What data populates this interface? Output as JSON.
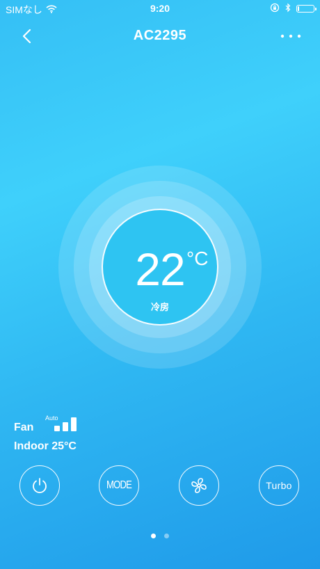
{
  "status_bar": {
    "carrier": "SIMなし",
    "time": "9:20",
    "icons": [
      "wifi-icon",
      "orientation-lock-icon",
      "bluetooth-icon",
      "battery-icon"
    ],
    "battery_level": 0.1
  },
  "nav": {
    "title": "AC2295",
    "back_icon": "chevron-left-icon",
    "more_icon": "more-dots-icon"
  },
  "thermostat": {
    "temperature": "22",
    "unit": "°C",
    "mode": "冷房"
  },
  "fan": {
    "label": "Fan",
    "speed": "Auto",
    "level_bars": 3
  },
  "indoor": {
    "text": "Indoor 25°C"
  },
  "controls": {
    "power_icon": "power-icon",
    "mode_label": "MODE",
    "fan_icon": "fan-icon",
    "turbo_label": "Turbo"
  },
  "pager": {
    "pages": 2,
    "current": 1
  },
  "colors": {
    "background_top": "#3fd0fb",
    "background_bottom": "#1f9ae9",
    "foreground": "#ffffff"
  }
}
